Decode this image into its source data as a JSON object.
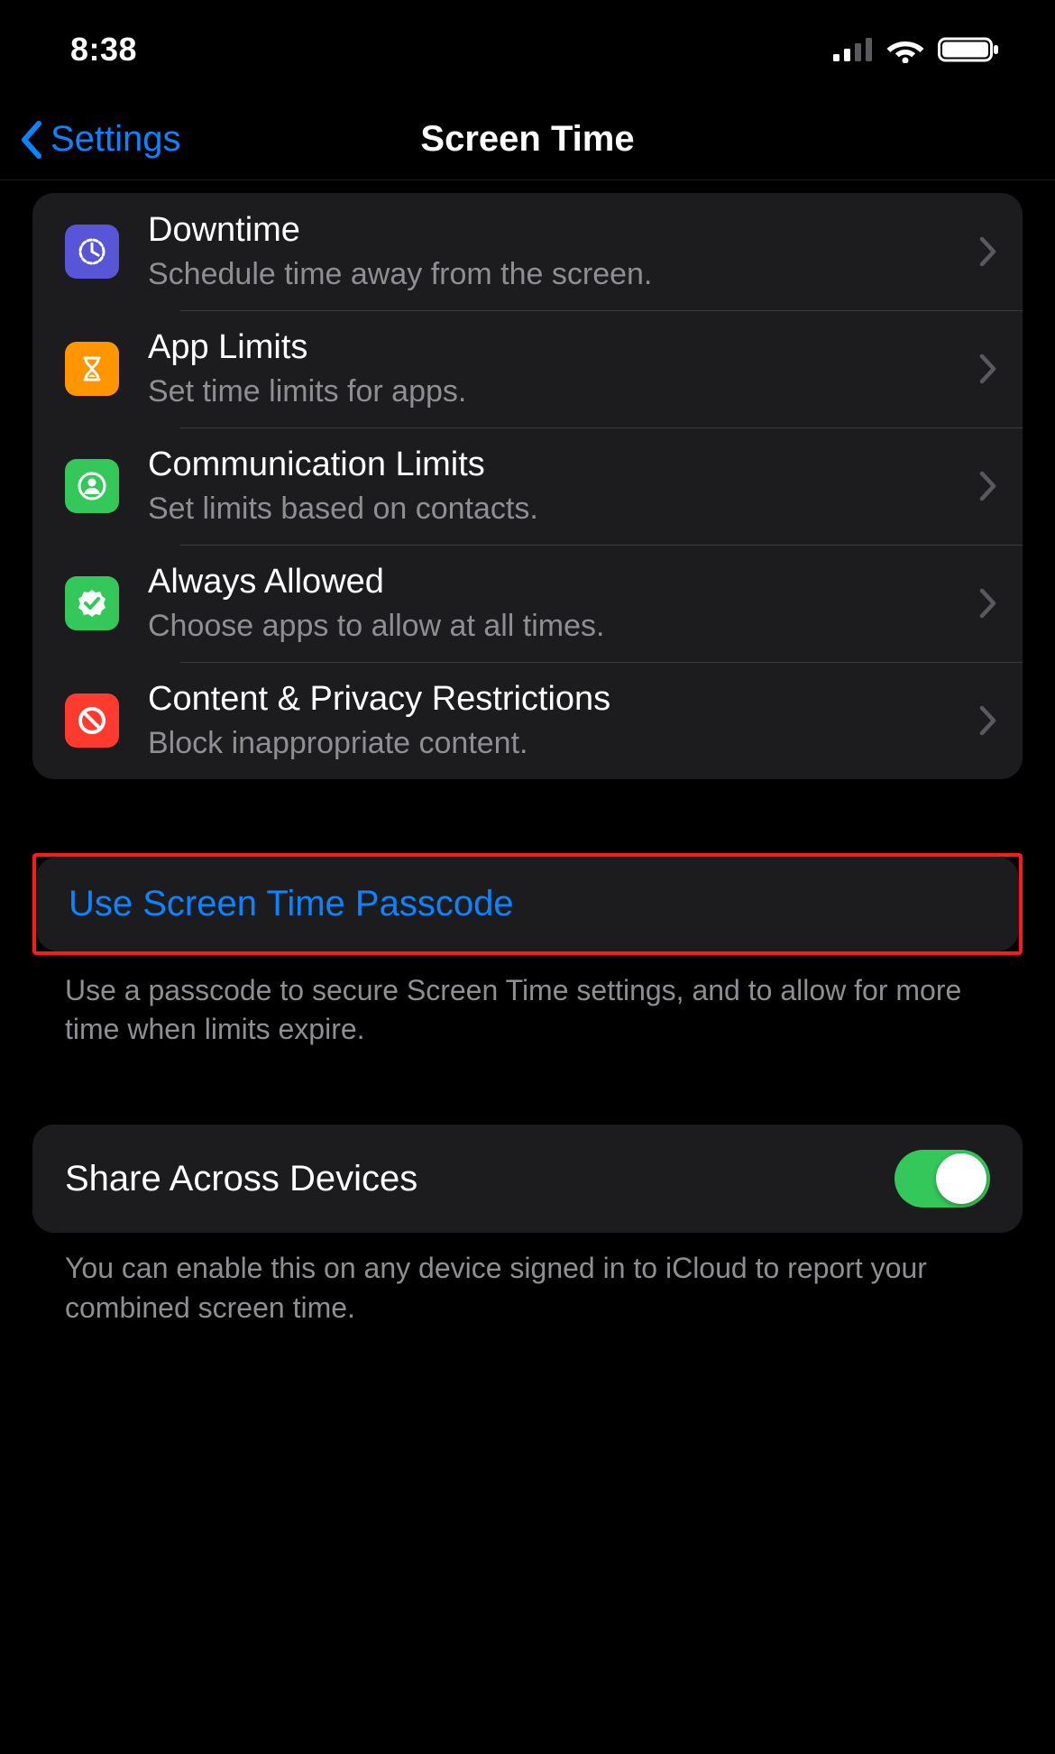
{
  "status": {
    "time": "8:38"
  },
  "nav": {
    "back_label": "Settings",
    "title": "Screen Time"
  },
  "rows": {
    "downtime": {
      "title": "Downtime",
      "subtitle": "Schedule time away from the screen."
    },
    "applimits": {
      "title": "App Limits",
      "subtitle": "Set time limits for apps."
    },
    "comm": {
      "title": "Communication Limits",
      "subtitle": "Set limits based on contacts."
    },
    "always": {
      "title": "Always Allowed",
      "subtitle": "Choose apps to allow at all times."
    },
    "content": {
      "title": "Content & Privacy Restrictions",
      "subtitle": "Block inappropriate content."
    }
  },
  "passcode": {
    "label": "Use Screen Time Passcode",
    "footer": "Use a passcode to secure Screen Time settings, and to allow for more time when limits expire."
  },
  "share": {
    "label": "Share Across Devices",
    "on": true,
    "footer": "You can enable this on any device signed in to iCloud to report your combined screen time."
  }
}
